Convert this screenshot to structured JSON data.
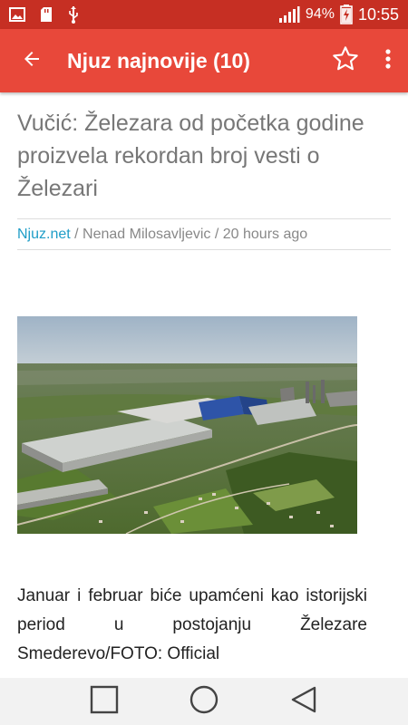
{
  "status_bar": {
    "battery_percent": "94%",
    "time": "10:55",
    "icons": [
      "image-icon",
      "sd-card-icon",
      "usb-icon",
      "signal-icon",
      "battery-charging-icon"
    ]
  },
  "app_bar": {
    "title": "Njuz najnovije (10)",
    "back_icon": "arrow-back-icon",
    "star_icon": "star-outline-icon",
    "menu_icon": "more-vert-icon",
    "color": "#e8483a",
    "status_color": "#c62f23"
  },
  "article": {
    "title": "Vučić: Železara od početka godine proizvela rekordan broj vesti o Železari",
    "source": "Njuz.net",
    "author_time": " / Nenad Milosavljevic / 20 hours ago",
    "image_alt": "aerial-factory-photo",
    "caption": "Januar i februar biće upamćeni kao istorijski period u postojanju Železare Smederevo/FOTO: Official"
  },
  "nav_bar": {
    "icons": [
      "recent-apps-icon",
      "home-icon",
      "back-triangle-icon"
    ]
  }
}
